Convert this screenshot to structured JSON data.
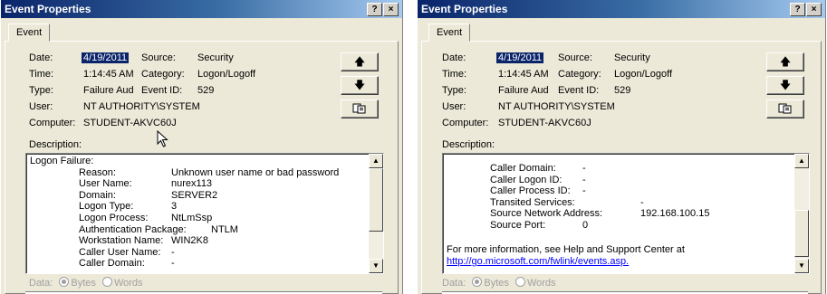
{
  "left": {
    "title": "Event Properties",
    "help_btn": "?",
    "close_btn": "×",
    "tab": "Event",
    "date_label": "Date:",
    "date_value": "4/19/2011",
    "source_label": "Source:",
    "source_value": "Security",
    "time_label": "Time:",
    "time_value": "1:14:45 AM",
    "category_label": "Category:",
    "category_value": "Logon/Logoff",
    "type_label": "Type:",
    "type_value": "Failure Aud",
    "eventid_label": "Event ID:",
    "eventid_value": "529",
    "user_label": "User:",
    "user_value": "NT AUTHORITY\\SYSTEM",
    "computer_label": "Computer:",
    "computer_value": "STUDENT-AKVC60J",
    "description_label": "Description:",
    "description_lines": [
      {
        "label": "Logon Failure:",
        "value": ""
      },
      {
        "label": "Reason:",
        "value": "Unknown user name or bad password"
      },
      {
        "label": "User Name:",
        "value": "nurex113"
      },
      {
        "label": "Domain:",
        "value": "SERVER2"
      },
      {
        "label": "Logon Type:",
        "value": "3"
      },
      {
        "label": "Logon Process:",
        "value": "NtLmSsp"
      },
      {
        "label": "Authentication Package:",
        "value": "NTLM"
      },
      {
        "label": "Workstation Name:",
        "value": "WIN2K8"
      },
      {
        "label": "Caller User Name:",
        "value": "-"
      },
      {
        "label": "Caller Domain:",
        "value": "-"
      }
    ],
    "data_label": "Data:",
    "bytes_label": "Bytes",
    "words_label": "Words"
  },
  "right": {
    "title": "Event Properties",
    "help_btn": "?",
    "close_btn": "×",
    "tab": "Event",
    "date_label": "Date:",
    "date_value": "4/19/2011",
    "source_label": "Source:",
    "source_value": "Security",
    "time_label": "Time:",
    "time_value": "1:14:45 AM",
    "category_label": "Category:",
    "category_value": "Logon/Logoff",
    "type_label": "Type:",
    "type_value": "Failure Aud",
    "eventid_label": "Event ID:",
    "eventid_value": "529",
    "user_label": "User:",
    "user_value": "NT AUTHORITY\\SYSTEM",
    "computer_label": "Computer:",
    "computer_value": "STUDENT-AKVC60J",
    "description_label": "Description:",
    "description_lines": [
      {
        "label": "Caller Domain:",
        "value": "-"
      },
      {
        "label": "Caller Logon ID:",
        "value": "-"
      },
      {
        "label": "Caller Process ID:",
        "value": "-"
      },
      {
        "label": "Transited Services:",
        "value": "-"
      },
      {
        "label": "Source Network Address:",
        "value": "192.168.100.15"
      },
      {
        "label": "Source Port:",
        "value": "0"
      }
    ],
    "footer_text": "For more information, see Help and Support Center at",
    "footer_link": "http://go.microsoft.com/fwlink/events.asp.",
    "data_label": "Data:",
    "bytes_label": "Bytes",
    "words_label": "Words"
  },
  "icons": {
    "up": "up-arrow-icon",
    "down": "down-arrow-icon",
    "copy": "copy-icon",
    "cursor": "mouse-pointer-icon"
  },
  "colors": {
    "title_start": "#0a246a",
    "title_end": "#a6caf0",
    "selection": "#0a246a",
    "link": "#0000ff",
    "dialog_bg": "#ece9d8"
  }
}
